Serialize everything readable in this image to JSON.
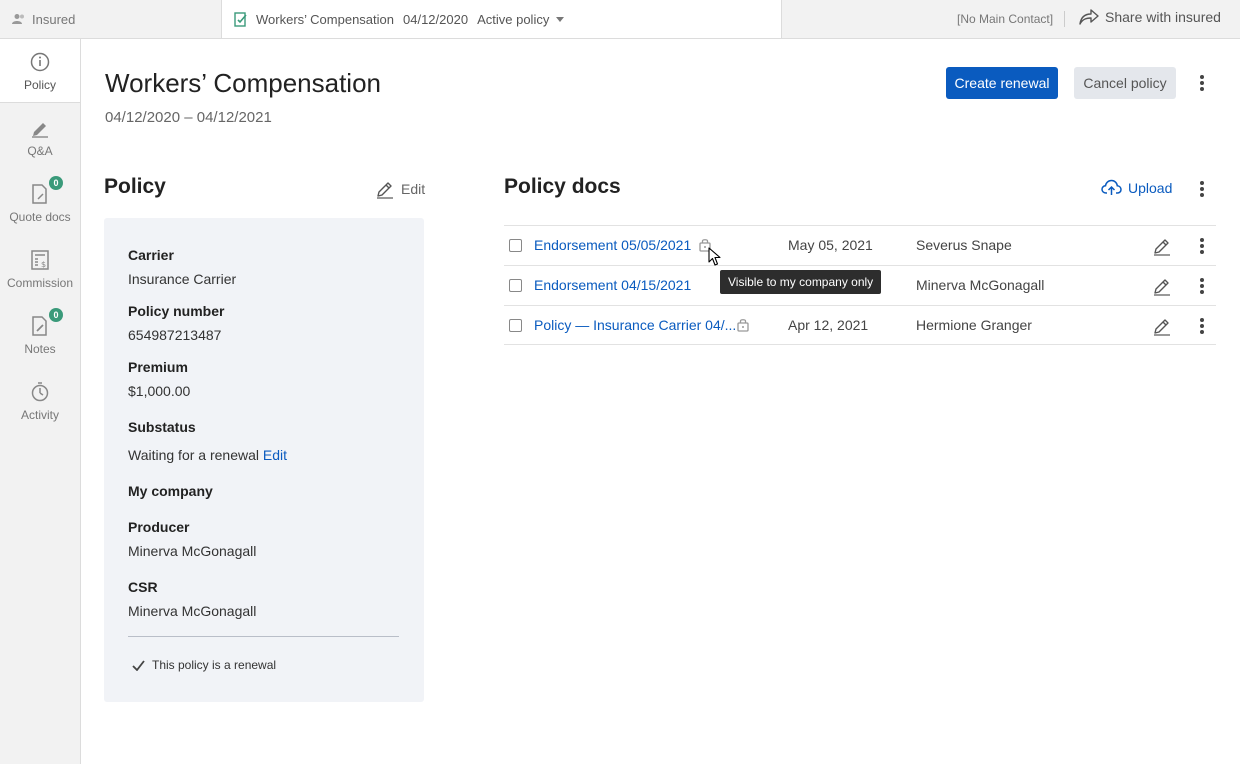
{
  "topbar": {
    "insured_label": "Insured",
    "policy_name": "Workers’ Compensation",
    "policy_date": "04/12/2020",
    "policy_status": "Active policy",
    "main_contact": "[No Main Contact]",
    "share_label": "Share with insured"
  },
  "sidebar": {
    "items": [
      {
        "label": "Policy",
        "icon": "info-icon"
      },
      {
        "label": "Q&A",
        "icon": "pen-icon"
      },
      {
        "label": "Quote docs",
        "icon": "document-clip-icon",
        "badge": "0"
      },
      {
        "label": "Commission",
        "icon": "calculator-icon"
      },
      {
        "label": "Notes",
        "icon": "note-icon",
        "badge": "0"
      },
      {
        "label": "Activity",
        "icon": "activity-icon"
      }
    ]
  },
  "header": {
    "title": "Workers’ Compensation",
    "dates": "04/12/2020 – 04/12/2021",
    "create_renewal": "Create renewal",
    "cancel_policy": "Cancel policy"
  },
  "policy": {
    "title": "Policy",
    "edit_label": "Edit",
    "carrier_label": "Carrier",
    "carrier_value": "Insurance Carrier",
    "number_label": "Policy number",
    "number_value": "654987213487",
    "premium_label": "Premium",
    "premium_value": "$1,000.00",
    "substatus_label": "Substatus",
    "substatus_value": "Waiting for a renewal",
    "substatus_edit": "Edit",
    "company_label": "My company",
    "producer_label": "Producer",
    "producer_value": "Minerva McGonagall",
    "csr_label": "CSR",
    "csr_value": "Minerva McGonagall",
    "renewal_note": "This policy is a renewal"
  },
  "docs": {
    "title": "Policy docs",
    "upload_label": "Upload",
    "tooltip": "Visible to my company only",
    "rows": [
      {
        "name": "Endorsement 05/05/2021",
        "date": "May 05, 2021",
        "user": "Severus Snape",
        "locked": true
      },
      {
        "name": "Endorsement 04/15/2021",
        "date": "",
        "user": "Minerva McGonagall",
        "locked": false
      },
      {
        "name": "Policy — Insurance Carrier 04/...",
        "date": "Apr 12, 2021",
        "user": "Hermione Granger",
        "locked": true
      }
    ]
  },
  "colors": {
    "accent": "#0a5bbf",
    "badge": "#3a9a7a",
    "tooltip_bg": "#2d2d2d"
  }
}
